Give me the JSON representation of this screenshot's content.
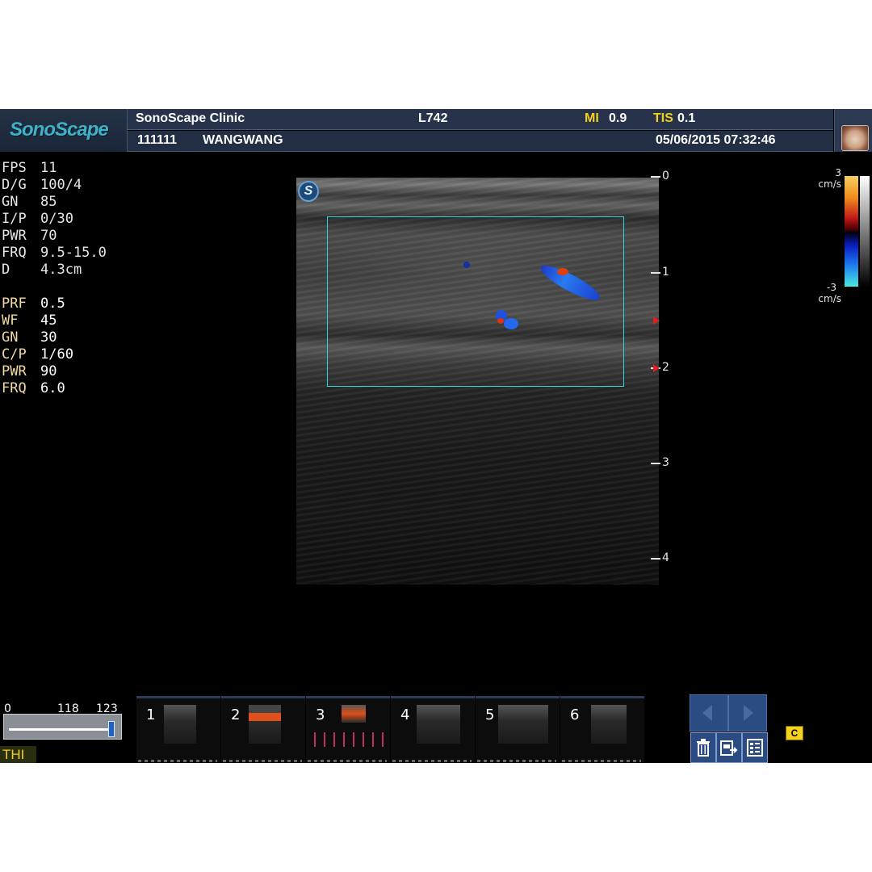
{
  "header": {
    "brand": "SonoScape",
    "clinic": "SonoScape Clinic",
    "probe": "L742",
    "mi_label": "MI",
    "mi_value": "0.9",
    "tis_label": "TIS",
    "tis_value": "0.1",
    "patient_id": "111111",
    "patient_name": "WANGWANG",
    "datetime": "05/06/2015 07:32:46"
  },
  "params_bmode": [
    {
      "k": "FPS",
      "v": "11"
    },
    {
      "k": "D/G",
      "v": "100/4"
    },
    {
      "k": "GN",
      "v": "85"
    },
    {
      "k": "I/P",
      "v": "0/30"
    },
    {
      "k": "PWR",
      "v": "70"
    },
    {
      "k": "FRQ",
      "v": "9.5-15.0"
    },
    {
      "k": "D",
      "v": "4.3cm"
    }
  ],
  "params_color": [
    {
      "k": "PRF",
      "v": "0.5"
    },
    {
      "k": "WF",
      "v": "45"
    },
    {
      "k": "GN",
      "v": "30"
    },
    {
      "k": "C/P",
      "v": "1/60"
    },
    {
      "k": "PWR",
      "v": "90"
    },
    {
      "k": "FRQ",
      "v": "6.0"
    }
  ],
  "depth_scale": [
    "0",
    "1",
    "2",
    "3",
    "4"
  ],
  "color_scale": {
    "top": "3",
    "bottom": "-3",
    "unit": "cm/s"
  },
  "image_badge": "S",
  "slider": {
    "min": "0",
    "mid": "118",
    "max": "123",
    "value_fraction": 0.96
  },
  "thi_label": "THI",
  "thumbnails": [
    "1",
    "2",
    "3",
    "4",
    "5",
    "6"
  ],
  "c_icon": "C",
  "colors": {
    "accent_yellow": "#f2d21c",
    "roi_cyan": "#2fd6d8",
    "header_bg": "#26334a"
  }
}
